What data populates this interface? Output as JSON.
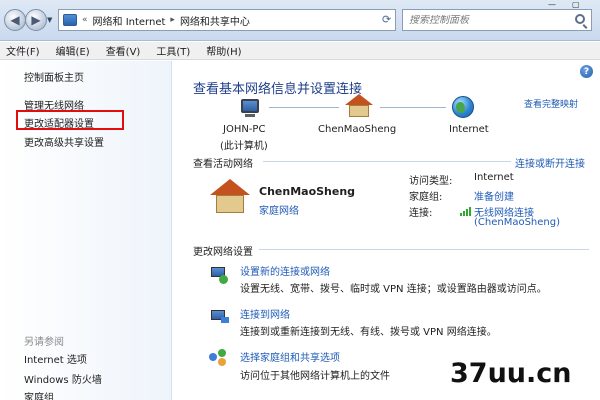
{
  "address": {
    "breadcrumb": [
      "网络和 Internet",
      "网络和共享中心"
    ],
    "search_placeholder": "搜索控制面板"
  },
  "menu": [
    "文件(F)",
    "编辑(E)",
    "查看(V)",
    "工具(T)",
    "帮助(H)"
  ],
  "sidebar": {
    "home": "控制面板主页",
    "items": [
      "管理无线网络",
      "更改适配器设置",
      "更改高级共享设置"
    ],
    "see_also_title": "另请参阅",
    "see_also": [
      "Internet 选项",
      "Windows 防火墙",
      "家庭组"
    ]
  },
  "main": {
    "title": "查看基本网络信息并设置连接",
    "full_map_link": "查看完整映射",
    "nodes": {
      "pc_name": "JOHN-PC",
      "pc_sub": "(此计算机)",
      "network": "ChenMaoSheng",
      "internet": "Internet"
    },
    "active_head": "查看活动网络",
    "connect_link": "连接或断开连接",
    "network_name": "ChenMaoSheng",
    "network_type": "家庭网络",
    "access_label": "访问类型:",
    "access_value": "Internet",
    "homegroup_label": "家庭组:",
    "homegroup_value": "准备创建",
    "connection_label": "连接:",
    "connection_value": "无线网络连接",
    "connection_value2": "(ChenMaoSheng)",
    "change_head": "更改网络设置",
    "tasks": [
      {
        "title": "设置新的连接或网络",
        "desc": "设置无线、宽带、拨号、临时或 VPN 连接；或设置路由器或访问点。"
      },
      {
        "title": "连接到网络",
        "desc": "连接到或重新连接到无线、有线、拨号或 VPN 网络连接。"
      },
      {
        "title": "选择家庭组和共享选项",
        "desc": "访问位于其他网络计算机上的文件"
      }
    ]
  },
  "watermark": "37uu.cn",
  "colors": {
    "link": "#1f5bb6",
    "title": "#1e3f8a",
    "highlight_box": "#e20d0d"
  }
}
